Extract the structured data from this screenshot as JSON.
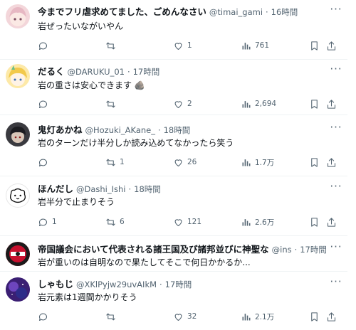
{
  "tweets": [
    {
      "name": "今までフリ虐求めてました、ごめんなさい",
      "handle": "@timai_gami",
      "time": "16時間",
      "text": "岩ぜったいながいやん",
      "reply_count": "",
      "retweet_count": "",
      "like_count": "1",
      "views": "761",
      "avatar_color": "#f3d6da"
    },
    {
      "name": "だるく",
      "handle": "@DARUKU_01",
      "time": "17時間",
      "text": "岩の重さは安心できます",
      "emoji": "🪨",
      "reply_count": "",
      "retweet_count": "",
      "like_count": "2",
      "views": "2,694",
      "avatar_color": "#fde9a8"
    },
    {
      "name": "鬼灯あかね",
      "handle": "@Hozuki_AKane_",
      "time": "18時間",
      "text": "岩のターンだけ半分しか読み込めてなかったら笑う",
      "reply_count": "",
      "retweet_count": "1",
      "like_count": "26",
      "views": "1.7万",
      "avatar_color": "#3a3a3f"
    },
    {
      "name": "ほんだし",
      "handle": "@Dashi_Ishi",
      "time": "18時間",
      "text": "岩半分で止まりそう",
      "reply_count": "1",
      "retweet_count": "6",
      "like_count": "121",
      "views": "2.6万",
      "avatar_color": "#ffffff"
    },
    {
      "name": "帝国議会において代表される諸王国及び諸邦並びに神聖な",
      "handle": "@ins",
      "time": "17時間",
      "text": "岩が重いのは自明なので果たしてそこで何日かかるか...",
      "avatar_color": "#c8102e"
    },
    {
      "name": "しゃもじ",
      "handle": "@XKlPyjw29uvAIkM",
      "time": "17時間",
      "text": "岩元素は1週間かかりそう",
      "reply_count": "",
      "retweet_count": "",
      "like_count": "32",
      "views": "2.1万",
      "avatar_color": "#4b2a8a"
    }
  ],
  "icons": {
    "more": "more-icon",
    "reply": "reply-icon",
    "retweet": "retweet-icon",
    "like": "heart-icon",
    "views": "views-icon",
    "bookmark": "bookmark-icon",
    "share": "share-icon"
  }
}
